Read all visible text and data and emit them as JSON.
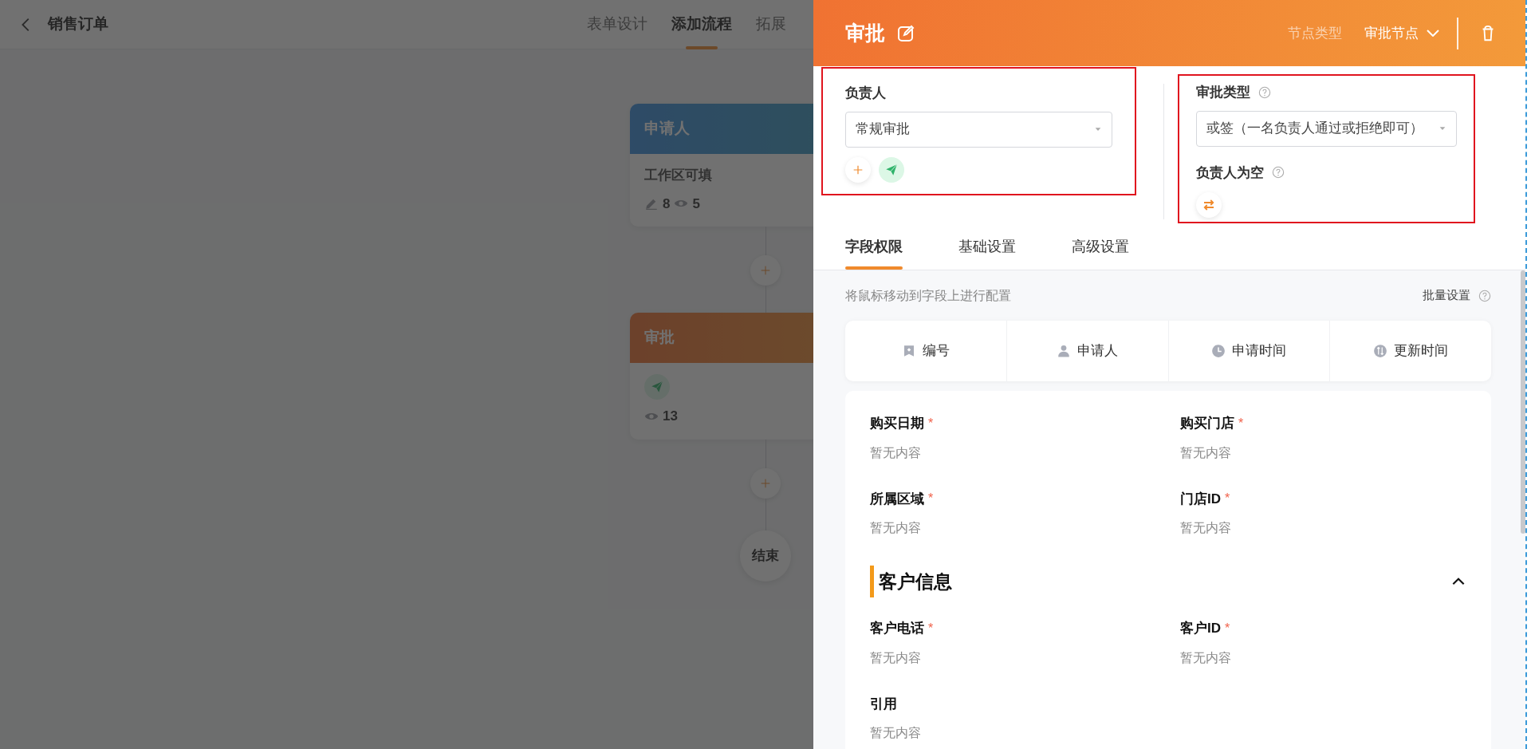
{
  "page": {
    "title": "销售订单",
    "tabs": [
      {
        "label": "表单设计",
        "selected": false
      },
      {
        "label": "添加流程",
        "selected": true
      },
      {
        "label": "拓展",
        "selected": false
      }
    ]
  },
  "flow": {
    "nodes": [
      {
        "kind": "applicant",
        "title": "申请人",
        "subtitle": "工作区可填",
        "edit_count": "8",
        "view_count": "5"
      },
      {
        "kind": "approval",
        "title": "审批",
        "view_count": "13"
      }
    ],
    "end": "结束"
  },
  "drawer": {
    "title": "审批",
    "node_type_label": "节点类型",
    "node_type": "审批节点",
    "assignee": {
      "label": "负责人",
      "value": "常规审批"
    },
    "approval_type": {
      "label": "审批类型",
      "value": "或签（一名负责人通过或拒绝即可）"
    },
    "empty_assignee": {
      "label": "负责人为空"
    },
    "tabs": [
      {
        "label": "字段权限",
        "selected": true
      },
      {
        "label": "基础设置",
        "selected": false
      },
      {
        "label": "高级设置",
        "selected": false
      }
    ],
    "hint": "将鼠标移动到字段上进行配置",
    "batch": "批量设置",
    "system_fields": [
      {
        "kind": "number",
        "label": "编号"
      },
      {
        "kind": "person",
        "label": "申请人"
      },
      {
        "kind": "clock",
        "label": "申请时间"
      },
      {
        "kind": "update",
        "label": "更新时间"
      }
    ],
    "form_items": [
      {
        "kind": "field",
        "label": "购买日期",
        "required_mark": "*",
        "value": "暂无内容"
      },
      {
        "kind": "field",
        "label": "购买门店",
        "required_mark": "*",
        "value": "暂无内容"
      },
      {
        "kind": "field",
        "label": "所属区域",
        "required_mark": "*",
        "value": "暂无内容"
      },
      {
        "kind": "field",
        "label": "门店ID",
        "required_mark": "*",
        "value": "暂无内容"
      },
      {
        "kind": "section",
        "title": "客户信息",
        "expanded": true
      },
      {
        "kind": "field",
        "label": "客户电话",
        "required_mark": "*",
        "value": "暂无内容"
      },
      {
        "kind": "field",
        "label": "客户ID",
        "required_mark": "*",
        "value": "暂无内容"
      },
      {
        "kind": "field",
        "label": "引用",
        "value": "暂无内容"
      }
    ]
  }
}
